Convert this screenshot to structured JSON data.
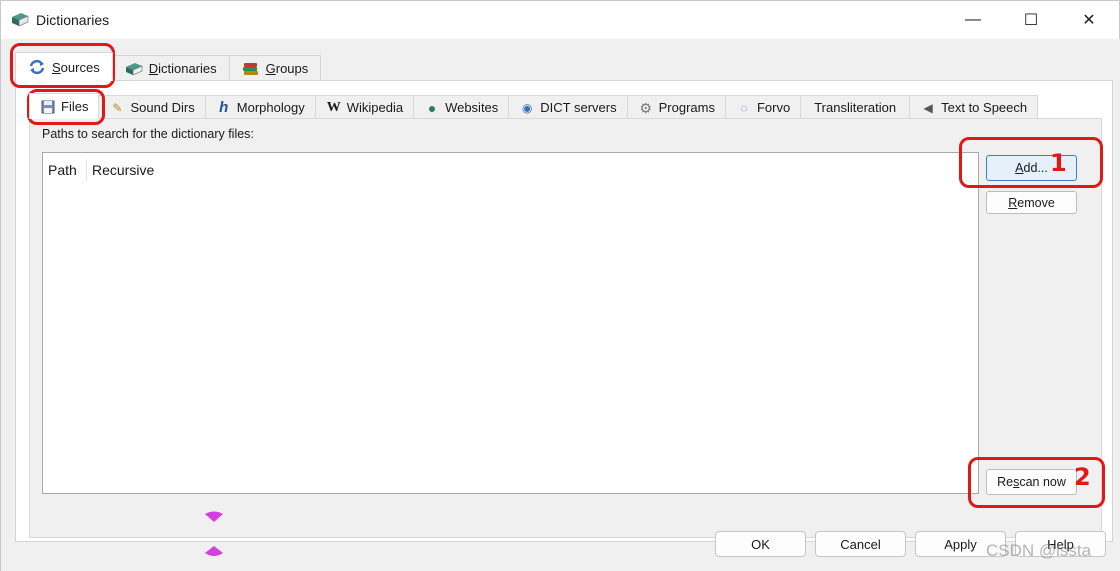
{
  "window": {
    "title": "Dictionaries",
    "minimize_glyph": "—",
    "maximize_glyph": "☐",
    "close_glyph": "✕"
  },
  "top_tabs": [
    {
      "label": "Sources",
      "underline": "S",
      "rest": "ources",
      "icon": "refresh-icon",
      "active": true
    },
    {
      "label": "Dictionaries",
      "underline": "D",
      "rest": "ictionaries",
      "icon": "book-icon"
    },
    {
      "label": "Groups",
      "underline": "G",
      "rest": "roups",
      "icon": "books-stack-icon"
    }
  ],
  "sub_tabs": [
    {
      "label": "Files",
      "icon": "floppy-icon",
      "glyph": "▣",
      "active": true
    },
    {
      "label": "Sound Dirs",
      "icon": "pencil-icon",
      "glyph": "✎"
    },
    {
      "label": "Morphology",
      "icon": "h-letter-icon",
      "glyph": "h"
    },
    {
      "label": "Wikipedia",
      "icon": "wikipedia-icon",
      "glyph": "W"
    },
    {
      "label": "Websites",
      "icon": "globe-icon",
      "glyph": "●"
    },
    {
      "label": "DICT servers",
      "icon": "network-icon",
      "glyph": "◉"
    },
    {
      "label": "Programs",
      "icon": "gear-icon",
      "glyph": "⚙"
    },
    {
      "label": "Forvo",
      "icon": "forvo-icon",
      "glyph": "◌"
    },
    {
      "label": "Transliteration",
      "icon": "",
      "glyph": ""
    },
    {
      "label": "Text to Speech",
      "icon": "speaker-icon",
      "glyph": "◀"
    }
  ],
  "files_pane": {
    "paths_label": "Paths to search for the dictionary files:",
    "columns": [
      "Path",
      "Recursive"
    ],
    "add_button": {
      "underline": "A",
      "rest": "dd..."
    },
    "remove_button": {
      "underline": "R",
      "rest": "emove"
    },
    "rescan_button": {
      "pre": "Re",
      "underline": "s",
      "rest": "can now"
    }
  },
  "annotations": {
    "one": "1",
    "two": "2"
  },
  "footer": {
    "ok": "OK",
    "cancel": "Cancel",
    "apply": "Apply",
    "help": "Help"
  },
  "watermark": "CSDN @lssta",
  "colors": {
    "annotation": "#e01818",
    "accent": "#3c7fd0",
    "marker": "#d63ee0"
  }
}
